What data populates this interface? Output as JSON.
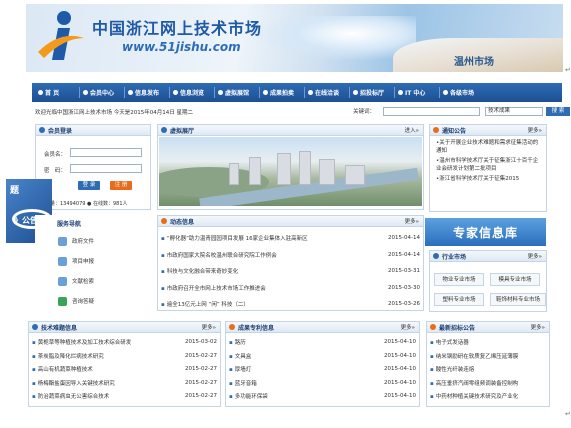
{
  "header": {
    "site_title": "中国浙江网上技术市场",
    "site_url": "www.51jishu.com",
    "city": "温州市场",
    "mark": "↵"
  },
  "nav": {
    "items": [
      "首 页",
      "会员中心",
      "信息发布",
      "信息浏览",
      "虚拟展馆",
      "成果拍卖",
      "在线洽谈",
      "招投标厅",
      "IT 中心",
      "各级市场"
    ]
  },
  "welcome": {
    "text": "欢迎光临中国浙江网上技术市场 今天是2015年04月14日 星期二",
    "keyword_label": "关键词：",
    "select_value": "技术成果",
    "search_button": "搜 索"
  },
  "login": {
    "title": "会员登录",
    "member_label": "会员名：",
    "password_label": "密　码：",
    "login_button": "登 录",
    "register_button": "注 册",
    "visitors": "访问量：13494079 ● 在线数：981人"
  },
  "float_ad": {
    "line1": "题",
    "line2": "》公告"
  },
  "service": {
    "title": "服务导航",
    "items": [
      "政府文件",
      "项目申报",
      "文献检索",
      "咨询答疑"
    ]
  },
  "expo": {
    "title": "虚拟展厅",
    "more": "进入»"
  },
  "notice": {
    "title": "通知公告",
    "more": "更多»",
    "items": [
      "关于开展企业技术难题和需求征集活动的通知",
      "温州市科学技术厅关于征集浙江十百千企业会研发计划第二批项目",
      "浙江省科学技术厅关于征集2015"
    ]
  },
  "dynamic": {
    "title": "动态信息",
    "more": "更多»",
    "items": [
      {
        "t": "“孵化器”助力温青园园项目发展 16家企业集体入驻高新区",
        "d": "2015-04-14"
      },
      {
        "t": "市政府国家大院名校温州联合研究院工作例会",
        "d": "2015-04-14"
      },
      {
        "t": "科技与文化融合带来奇妙变化",
        "d": "2015-03-31"
      },
      {
        "t": "市政府召开全市网上技术市场工作推进会",
        "d": "2015-03-30"
      },
      {
        "t": "遍全13亿元上网 “闲” 科技（二）",
        "d": "2015-03-26"
      }
    ]
  },
  "expert": {
    "label": "专家信息库"
  },
  "industry": {
    "title": "行业市场",
    "more": "更多»",
    "items": [
      "物业专业市场",
      "模具专业市场",
      "塑料专业市场",
      "鞋饰材料专业市场"
    ]
  },
  "tech_problems": {
    "title": "技术难题信息",
    "more": "更多»",
    "items": [
      {
        "t": "黄栀草等种植技术及加工技术综合研发",
        "d": "2015-03-02"
      },
      {
        "t": "茶炭脂及降化烂病技术研究",
        "d": "2015-02-27"
      },
      {
        "t": "高山有机蔬菜种植技术",
        "d": "2015-02-27"
      },
      {
        "t": "杨梅酯盐蛋因导入关键技术研究",
        "d": "2015-02-27"
      },
      {
        "t": "防治蔬菜病虫无公害综合技术",
        "d": "2015-02-27"
      }
    ]
  },
  "patents": {
    "title": "成果专利信息",
    "more": "更多»",
    "items": [
      {
        "t": "路历",
        "d": "2015-04-10"
      },
      {
        "t": "文具盒",
        "d": "2015-04-10"
      },
      {
        "t": "厚墙灯",
        "d": "2015-04-10"
      },
      {
        "t": "蓝牙音箱",
        "d": "2015-04-10"
      },
      {
        "t": "多功能环保袋",
        "d": "2015-04-10"
      }
    ]
  },
  "tenders": {
    "title": "最新招标公告",
    "more": "更多»",
    "items": [
      "电子式发话器",
      "纳米钢励研在软质复乙烯压延薄膜",
      "酸性光纤装连熔",
      "高压垂挤汽阀零组频调装备控制构",
      "中药材种植关键技术研究及产业化"
    ]
  }
}
